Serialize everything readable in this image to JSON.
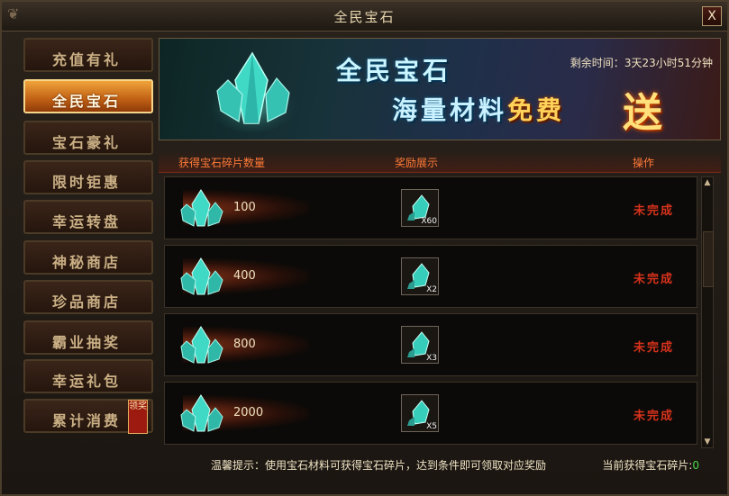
{
  "window": {
    "title": "全民宝石",
    "close_label": "X"
  },
  "sidebar": {
    "items": [
      {
        "label": "充值有礼",
        "active": false
      },
      {
        "label": "全民宝石",
        "active": true
      },
      {
        "label": "宝石豪礼",
        "active": false
      },
      {
        "label": "限时钜惠",
        "active": false
      },
      {
        "label": "幸运转盘",
        "active": false
      },
      {
        "label": "神秘商店",
        "active": false
      },
      {
        "label": "珍品商店",
        "active": false
      },
      {
        "label": "霸业抽奖",
        "active": false
      },
      {
        "label": "幸运礼包",
        "active": false
      },
      {
        "label": "累计消费",
        "active": false,
        "badge": "领奖"
      }
    ]
  },
  "banner": {
    "title_line1": "全民宝石",
    "title_line2_a": "海量材料",
    "title_line2_b": "免费",
    "title_send": "送",
    "countdown_label": "剩余时间：",
    "countdown_value": "3天23小时51分钟"
  },
  "table": {
    "headers": {
      "count": "获得宝石碎片数量",
      "reward": "奖励展示",
      "action": "操作"
    },
    "rows": [
      {
        "amount": "100",
        "reward_qty": "X60",
        "status": "未完成"
      },
      {
        "amount": "400",
        "reward_qty": "X2",
        "status": "未完成"
      },
      {
        "amount": "800",
        "reward_qty": "X3",
        "status": "未完成"
      },
      {
        "amount": "2000",
        "reward_qty": "X5",
        "status": "未完成"
      }
    ]
  },
  "footer": {
    "tip": "温馨提示：使用宝石材料可获得宝石碎片，达到条件即可领取对应奖励",
    "gained_label": "当前获得宝石碎片:",
    "gained_value": "0"
  },
  "colors": {
    "accent": "#c06014",
    "status_red": "#d8321c",
    "gain_green": "#48d848",
    "header_orange": "#ff7a38"
  },
  "icons": [
    "close-icon",
    "gem-icon",
    "gem-fragment-icon",
    "scroll-up-icon",
    "scroll-down-icon"
  ]
}
